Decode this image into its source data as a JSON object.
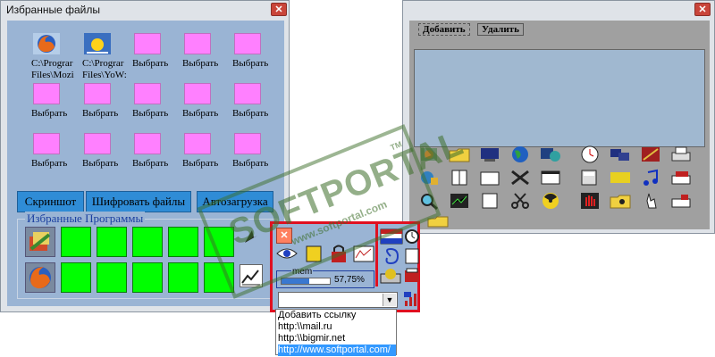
{
  "left_window": {
    "title": "Избранные файлы",
    "close_glyph": "✕",
    "favorites": [
      {
        "label": "C:\\Progra Files\\Mozi",
        "icon": "firefox-icon"
      },
      {
        "label": "C:\\Progra Files\\YoW:",
        "icon": "weather-sun-icon"
      },
      {
        "label": "Выбрать"
      },
      {
        "label": "Выбрать"
      },
      {
        "label": "Выбрать"
      },
      {
        "label": "Выбрать"
      },
      {
        "label": "Выбрать"
      },
      {
        "label": "Выбрать"
      },
      {
        "label": "Выбрать"
      },
      {
        "label": "Выбрать"
      },
      {
        "label": "Выбрать"
      },
      {
        "label": "Выбрать"
      },
      {
        "label": "Выбрать"
      },
      {
        "label": "Выбрать"
      },
      {
        "label": "Выбрать"
      }
    ],
    "fav_label_1a": "C:\\Prograr",
    "fav_label_1b": "Files\\Mozi",
    "fav_label_2a": "C:\\Prograr",
    "fav_label_2b": "Files\\YoW:",
    "select_label": "Выбрать",
    "buttons": {
      "screenshot": "Скриншот",
      "encrypt": "Шифровать файлы",
      "autostart": "Автозагрузка"
    },
    "programs_group_label": "Избранные Программы"
  },
  "right_window": {
    "close_glyph": "✕",
    "tab_add": "Добавить",
    "tab_delete": "Удалить"
  },
  "popup": {
    "mem_label": "mem",
    "mem_percent": "57,75%",
    "mem_fraction": 0.5775,
    "dropdown_items": [
      "Добавить ссылку",
      "http:\\\\mail.ru",
      "http:\\\\bigmir.net",
      "http://www.softportal.com/"
    ],
    "selected_index": 3
  },
  "watermark": {
    "brand": "SOFTPORTAL",
    "url": "www.softportal.com",
    "tm": "TM"
  },
  "colors": {
    "client_bg": "#9ab4d4",
    "slot_magenta": "#ff80ff",
    "slot_green": "#00ff00",
    "button_blue": "#2f8cd6",
    "popup_border": "#e01020",
    "selection_blue": "#3399ff"
  }
}
